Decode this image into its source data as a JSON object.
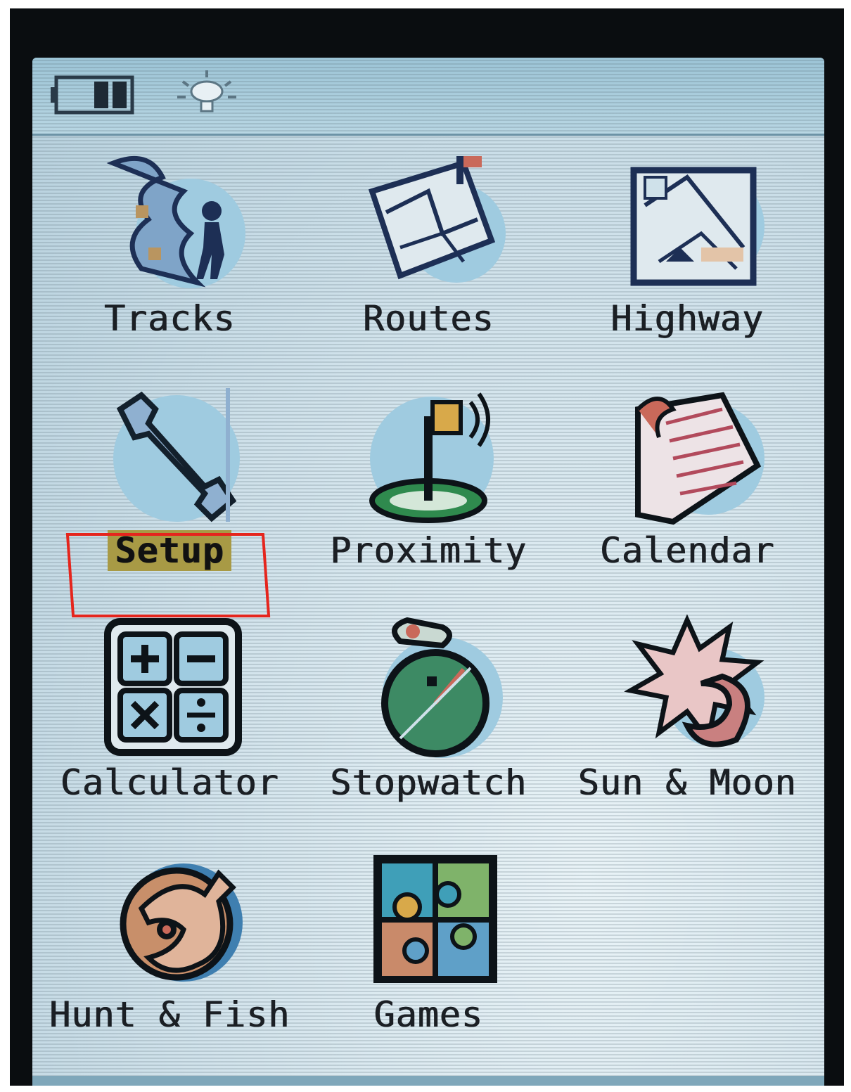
{
  "status_bar": {
    "battery_icon": "battery-icon",
    "backlight_icon": "backlight-icon"
  },
  "menu": {
    "items": [
      {
        "label": "Tracks",
        "icon": "tracks-icon"
      },
      {
        "label": "Routes",
        "icon": "routes-icon"
      },
      {
        "label": "Highway",
        "icon": "highway-icon"
      },
      {
        "label": "Setup",
        "icon": "wrench-icon",
        "selected": true
      },
      {
        "label": "Proximity",
        "icon": "proximity-icon"
      },
      {
        "label": "Calendar",
        "icon": "calendar-icon"
      },
      {
        "label": "Calculator",
        "icon": "calculator-icon"
      },
      {
        "label": "Stopwatch",
        "icon": "stopwatch-icon"
      },
      {
        "label": "Sun & Moon",
        "icon": "sun-moon-icon"
      },
      {
        "label": "Hunt & Fish",
        "icon": "hunt-fish-icon"
      },
      {
        "label": "Games",
        "icon": "games-icon"
      }
    ]
  },
  "colors": {
    "screen_bg": "#cfe1ea",
    "selection_bg": "#a89a45",
    "annotation_red": "#e5251d",
    "icon_outline": "#1b1f24"
  }
}
